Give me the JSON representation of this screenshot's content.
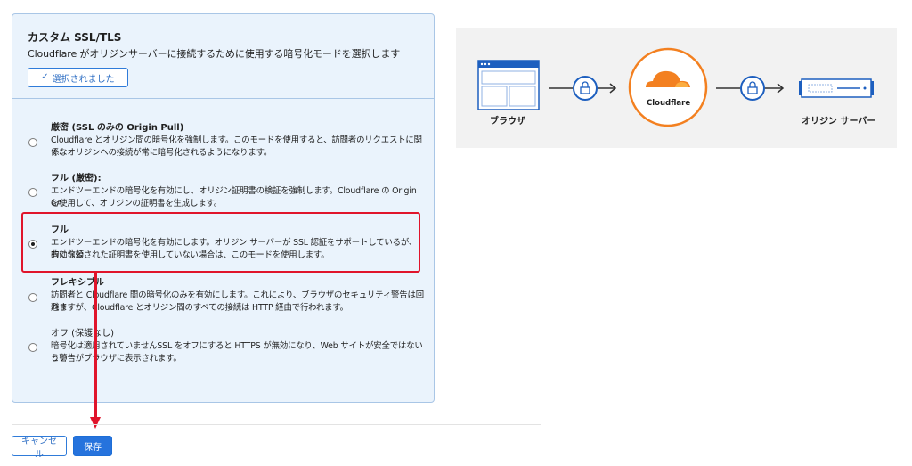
{
  "panel": {
    "title": "カスタム SSL/TLS",
    "description": "Cloudflare がオリジンサーバーに接続するために使用する暗号化モードを選択します",
    "selected_button": "選択されました"
  },
  "options": [
    {
      "label": "厳密 (SSL のみの Origin Pull)",
      "desc1": "Cloudflare とオリジン間の暗号化を強制します。このモードを使用すると、訪問者のリクエストに関係な",
      "desc2": "く、オリジンへの接続が常に暗号化されるようになります。",
      "selected": false
    },
    {
      "label": "フル (厳密):",
      "desc1": "エンドツーエンドの暗号化を有効にし、オリジン証明書の検証を強制します。Cloudflare の Origin CA",
      "desc2": "を使用して、オリジンの証明書を生成します。",
      "selected": false
    },
    {
      "label": "フル",
      "desc1": "エンドツーエンドの暗号化を有効にします。オリジン サーバーが SSL 認証をサポートしているが、有効な公",
      "desc2": "的に信頼された証明書を使用していない場合は、このモードを使用します。",
      "selected": true
    },
    {
      "label": "フレキシブル",
      "desc1": "訪問者と Cloudflare 間の暗号化のみを有効にします。これにより、ブラウザのセキュリティ警告は回避さ",
      "desc2": "れますが、Cloudflare とオリジン間のすべての接続は HTTP 経由で行われます。",
      "selected": false
    },
    {
      "label": "オフ (保護なし)",
      "desc1": "暗号化は適用されていませんSSL をオフにすると HTTPS が無効になり、Web サイトが安全ではないとい",
      "desc2": "う警告がブラウザに表示されます。",
      "selected": false
    }
  ],
  "actions": {
    "cancel": "キャンセル",
    "save": "保存"
  },
  "diagram": {
    "browser_label": "ブラウザ",
    "center_label": "Cloudflare",
    "origin_label": "オリジン サーバー",
    "icons": [
      "browser-window-icon",
      "lock-icon",
      "cloudflare-cloud-icon",
      "server-icon"
    ]
  },
  "colors": {
    "accent_blue": "#2673dd",
    "highlight_red": "#e0142b",
    "cloudflare_orange": "#f38020",
    "panel_bg": "#eaf3fc"
  }
}
